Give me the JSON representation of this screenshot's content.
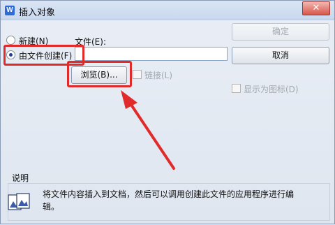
{
  "window": {
    "title": "插入对象",
    "app_icon": "W",
    "close_label": "✕"
  },
  "options": {
    "new_label": "新建(N)",
    "from_file_label": "由文件创建(F)",
    "selected": "from_file"
  },
  "file_field": {
    "label": "文件(E):",
    "value": ""
  },
  "buttons": {
    "ok": "确定",
    "cancel": "取消",
    "browse": "浏览(B)..."
  },
  "checkboxes": {
    "link_label": "链接(L)",
    "display_as_icon_label": "显示为图标(D)"
  },
  "description": {
    "title": "说明",
    "text": "将文件内容插入到文档，然后可以调用创建此文件的应用程序进行编辑。"
  },
  "colors": {
    "highlight": "#e12a2a",
    "title_bar": "#c9d8ee",
    "close_button": "#d8564a"
  }
}
